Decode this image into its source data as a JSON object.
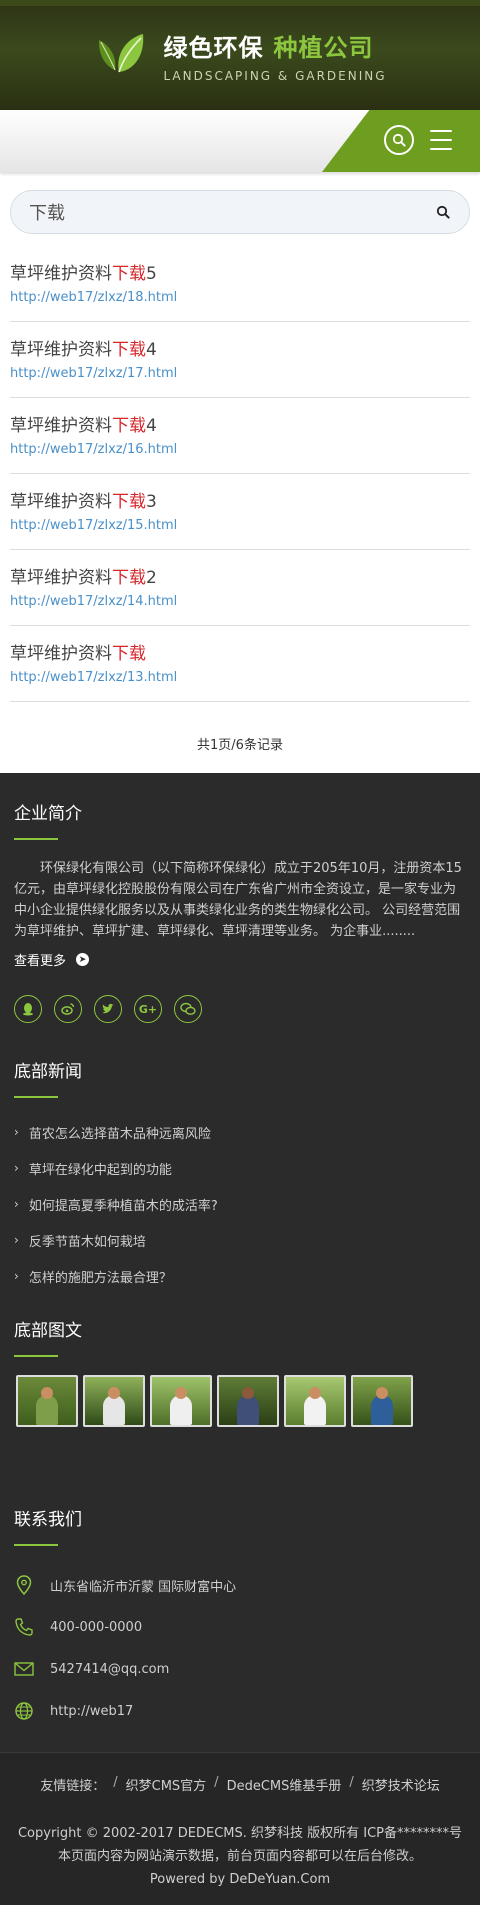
{
  "header": {
    "logo_cn_white": "绿色环保",
    "logo_cn_green": "种植公司",
    "logo_en": "LANDSCAPING & GARDENING"
  },
  "nav": {
    "search_icon": "search-icon",
    "menu_icon": "menu-icon"
  },
  "search": {
    "value": "下载",
    "placeholder": "下载"
  },
  "results": [
    {
      "prefix": "草坪维护资料",
      "highlight": "下载",
      "suffix": "5",
      "url": "http://web17/zlxz/18.html"
    },
    {
      "prefix": "草坪维护资料",
      "highlight": "下载",
      "suffix": "4",
      "url": "http://web17/zlxz/17.html"
    },
    {
      "prefix": "草坪维护资料",
      "highlight": "下载",
      "suffix": "4",
      "url": "http://web17/zlxz/16.html"
    },
    {
      "prefix": "草坪维护资料",
      "highlight": "下载",
      "suffix": "3",
      "url": "http://web17/zlxz/15.html"
    },
    {
      "prefix": "草坪维护资料",
      "highlight": "下载",
      "suffix": "2",
      "url": "http://web17/zlxz/14.html"
    },
    {
      "prefix": "草坪维护资料",
      "highlight": "下载",
      "suffix": "",
      "url": "http://web17/zlxz/13.html"
    }
  ],
  "pager": "共1页/6条记录",
  "company": {
    "title": "企业简介",
    "text": "环保绿化有限公司（以下简称环保绿化）成立于205年10月，注册资本15亿元，由草坪绿化控股股份有限公司在广东省广州市全资设立，是一家专业为中小企业提供绿化服务以及从事类绿化业务的类生物绿化公司。 公司经营范围为草坪维护、草坪扩建、草坪绿化、草坪清理等业务。 为企事业........",
    "more": "查看更多",
    "socials": [
      "qq-icon",
      "weibo-icon",
      "twitter-icon",
      "google-plus-icon",
      "wechat-icon"
    ]
  },
  "news": {
    "title": "底部新闻",
    "items": [
      "苗农怎么选择苗木品种远离风险",
      "草坪在绿化中起到的功能",
      "如何提高夏季种植苗木的成活率?",
      "反季节苗木如何栽培",
      "怎样的施肥方法最合理？"
    ]
  },
  "gallery": {
    "title": "底部图文"
  },
  "contact": {
    "title": "联系我们",
    "address": "山东省临沂市沂蒙 国际财富中心",
    "phone": "400-000-0000",
    "email": "5427414@qq.com",
    "web": "http://web17"
  },
  "footer": {
    "links_label": "友情链接：",
    "links": [
      "织梦CMS官方",
      "DedeCMS维基手册",
      "织梦技术论坛"
    ],
    "copyright": "Copyright © 2002-2017 DEDECMS. 织梦科技 版权所有 ICP备********号",
    "notice": "本页面内容为网站演示数据，前台页面内容都可以在后台修改。",
    "powered": "Powered by DeDeYuan.Com"
  },
  "colors": {
    "accent": "#8cc63f",
    "nav_green": "#6d9e1f",
    "highlight_red": "#d7262b",
    "link_blue": "#4a90c9",
    "dark_bg": "#2b2b2b"
  }
}
